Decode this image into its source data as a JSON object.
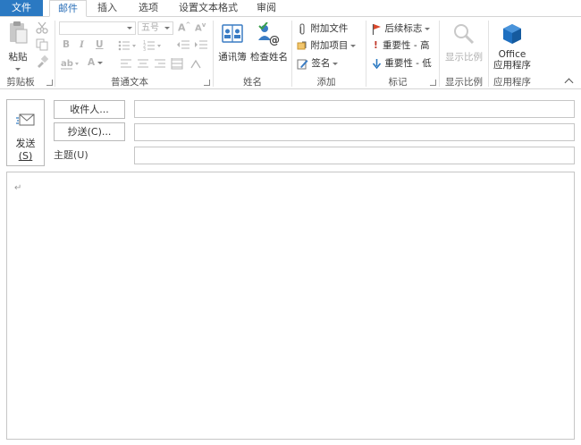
{
  "tabs": [
    {
      "label": "文件"
    },
    {
      "label": "邮件"
    },
    {
      "label": "插入"
    },
    {
      "label": "选项"
    },
    {
      "label": "设置文本格式"
    },
    {
      "label": "审阅"
    }
  ],
  "ribbon": {
    "clipboard": {
      "paste_label": "粘贴",
      "group_label": "剪贴板"
    },
    "basic_text": {
      "font_size_placeholder": "五号",
      "bold": "B",
      "italic": "I",
      "underline": "U",
      "font_color_letter": "A",
      "group_label": "普通文本"
    },
    "names": {
      "address_book": "通讯簿",
      "check_names": "检查姓名",
      "group_label": "姓名"
    },
    "include": {
      "attach_file": "附加文件",
      "attach_item": "附加项目",
      "signature": "签名",
      "group_label": "添加"
    },
    "tags": {
      "follow_up": "后续标志",
      "high_importance": "重要性 - 高",
      "low_importance": "重要性 - 低",
      "group_label": "标记"
    },
    "zoom": {
      "zoom_label": "显示比例",
      "group_label": "显示比例"
    },
    "apps": {
      "office_line1": "Office",
      "office_line2": "应用程序",
      "group_label": "应用程序"
    }
  },
  "compose": {
    "send_label": "发送",
    "send_hotkey": "(S)",
    "to_button": "收件人...",
    "cc_button": "抄送(C)...",
    "subject_label": "主题(U)",
    "to_value": "",
    "cc_value": "",
    "subject_value": "",
    "body_paragraph_mark": "↵"
  },
  "colors": {
    "file_tab": "#2b79c2",
    "active_tab_text": "#2b6fb8",
    "follow_up_flag": "#d9472b",
    "importance_high": "#c0392b",
    "importance_low": "#2b79c2",
    "office_icon": "#1e6fc0"
  }
}
